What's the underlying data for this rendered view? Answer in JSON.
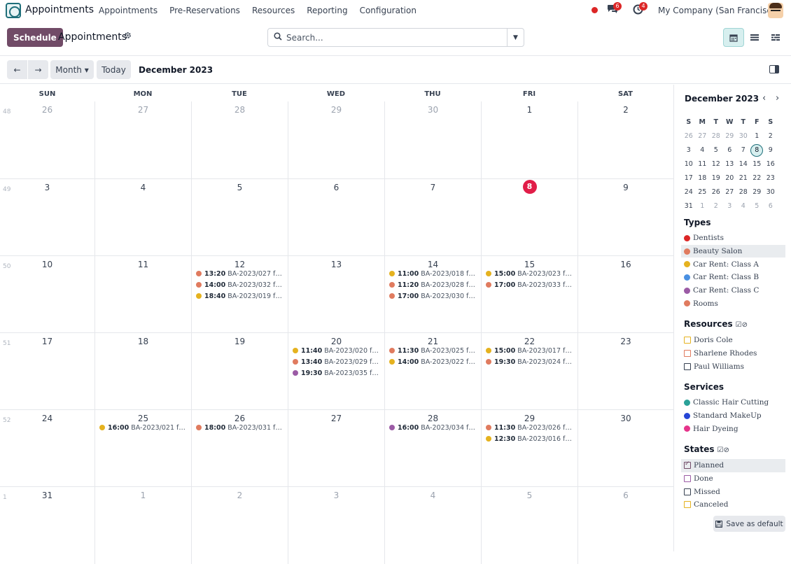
{
  "app": {
    "name": "Appointments"
  },
  "menu": [
    {
      "label": "Appointments"
    },
    {
      "label": "Pre-Reservations"
    },
    {
      "label": "Resources"
    },
    {
      "label": "Reporting"
    },
    {
      "label": "Configuration"
    }
  ],
  "systray": {
    "messages_count": "6",
    "activities_count": "4",
    "company": "My Company (San Francisco)",
    "status_color": "#dc2626"
  },
  "control_panel": {
    "schedule_label": "Schedule",
    "title": "Appointments",
    "search_placeholder": "Search..."
  },
  "toolbar": {
    "prev": "←",
    "next": "→",
    "scale_label": "Month ▾",
    "today_label": "Today",
    "range_title": "December 2023"
  },
  "weekdays": [
    "SUN",
    "MON",
    "TUE",
    "WED",
    "THU",
    "FRI",
    "SAT"
  ],
  "weeks": [
    {
      "num": "48",
      "days": [
        {
          "n": "26",
          "muted": true
        },
        {
          "n": "27",
          "muted": true
        },
        {
          "n": "28",
          "muted": true
        },
        {
          "n": "29",
          "muted": true
        },
        {
          "n": "30",
          "muted": true
        },
        {
          "n": "1"
        },
        {
          "n": "2"
        }
      ]
    },
    {
      "num": "49",
      "days": [
        {
          "n": "3"
        },
        {
          "n": "4"
        },
        {
          "n": "5"
        },
        {
          "n": "6"
        },
        {
          "n": "7"
        },
        {
          "n": "8",
          "today": true
        },
        {
          "n": "9"
        }
      ]
    },
    {
      "num": "50",
      "days": [
        {
          "n": "10"
        },
        {
          "n": "11"
        },
        {
          "n": "12",
          "events": [
            {
              "time": "13:20",
              "title": "BA-2023/027 for ...",
              "color": "#e07b5f"
            },
            {
              "time": "14:00",
              "title": "BA-2023/032 for ...",
              "color": "#e07b5f"
            },
            {
              "time": "18:40",
              "title": "BA-2023/019 for ...",
              "color": "#e5b21f"
            }
          ]
        },
        {
          "n": "13"
        },
        {
          "n": "14",
          "events": [
            {
              "time": "11:00",
              "title": "BA-2023/018 for ...",
              "color": "#e5b21f"
            },
            {
              "time": "11:20",
              "title": "BA-2023/028 for ...",
              "color": "#e07b5f"
            },
            {
              "time": "17:00",
              "title": "BA-2023/030 for ...",
              "color": "#e07b5f"
            }
          ]
        },
        {
          "n": "15",
          "events": [
            {
              "time": "15:00",
              "title": "BA-2023/023 for ...",
              "color": "#e5b21f"
            },
            {
              "time": "17:00",
              "title": "BA-2023/033 for ...",
              "color": "#e07b5f"
            }
          ]
        },
        {
          "n": "16"
        }
      ]
    },
    {
      "num": "51",
      "days": [
        {
          "n": "17"
        },
        {
          "n": "18"
        },
        {
          "n": "19"
        },
        {
          "n": "20",
          "events": [
            {
              "time": "11:40",
              "title": "BA-2023/020 for ...",
              "color": "#e5b21f"
            },
            {
              "time": "13:40",
              "title": "BA-2023/029 for ...",
              "color": "#e07b5f"
            },
            {
              "time": "19:30",
              "title": "BA-2023/035 for ...",
              "color": "#9b5ba5"
            }
          ]
        },
        {
          "n": "21",
          "events": [
            {
              "time": "11:30",
              "title": "BA-2023/025 for ...",
              "color": "#e07b5f"
            },
            {
              "time": "14:00",
              "title": "BA-2023/022 for ...",
              "color": "#e5b21f"
            }
          ]
        },
        {
          "n": "22",
          "events": [
            {
              "time": "15:00",
              "title": "BA-2023/017 for ...",
              "color": "#e5b21f"
            },
            {
              "time": "19:30",
              "title": "BA-2023/024 for ...",
              "color": "#e07b5f"
            }
          ]
        },
        {
          "n": "23"
        }
      ]
    },
    {
      "num": "52",
      "days": [
        {
          "n": "24"
        },
        {
          "n": "25",
          "events": [
            {
              "time": "16:00",
              "title": "BA-2023/021 for ...",
              "color": "#e5b21f"
            }
          ]
        },
        {
          "n": "26",
          "events": [
            {
              "time": "18:00",
              "title": "BA-2023/031 for ...",
              "color": "#e07b5f"
            }
          ]
        },
        {
          "n": "27"
        },
        {
          "n": "28",
          "events": [
            {
              "time": "16:00",
              "title": "BA-2023/034 for ...",
              "color": "#9b5ba5"
            }
          ]
        },
        {
          "n": "29",
          "events": [
            {
              "time": "11:30",
              "title": "BA-2023/026 for ...",
              "color": "#e07b5f"
            },
            {
              "time": "12:30",
              "title": "BA-2023/016 for ...",
              "color": "#e5b21f"
            }
          ]
        },
        {
          "n": "30"
        }
      ]
    },
    {
      "num": "1",
      "days": [
        {
          "n": "31"
        },
        {
          "n": "1",
          "muted": true
        },
        {
          "n": "2",
          "muted": true
        },
        {
          "n": "3",
          "muted": true
        },
        {
          "n": "4",
          "muted": true
        },
        {
          "n": "5",
          "muted": true
        },
        {
          "n": "6",
          "muted": true
        }
      ]
    }
  ],
  "mini_calendar": {
    "title": "December 2023",
    "prev": "‹",
    "next": "›",
    "weekdays": [
      "S",
      "M",
      "T",
      "W",
      "T",
      "F",
      "S"
    ],
    "rows": [
      [
        "26",
        "27",
        "28",
        "29",
        "30",
        "1",
        "2"
      ],
      [
        "3",
        "4",
        "5",
        "6",
        "7",
        "8",
        "9"
      ],
      [
        "10",
        "11",
        "12",
        "13",
        "14",
        "15",
        "16"
      ],
      [
        "17",
        "18",
        "19",
        "20",
        "21",
        "22",
        "23"
      ],
      [
        "24",
        "25",
        "26",
        "27",
        "28",
        "29",
        "30"
      ],
      [
        "31",
        "1",
        "2",
        "3",
        "4",
        "5",
        "6"
      ]
    ],
    "selected": "8"
  },
  "filters": {
    "types": {
      "title": "Types",
      "items": [
        {
          "label": "Dentists",
          "color": "#dc2626"
        },
        {
          "label": "Beauty Salon",
          "color": "#e07b5f",
          "highlighted": true
        },
        {
          "label": "Car Rent: Class A",
          "color": "#e5b21f"
        },
        {
          "label": "Car Rent: Class B",
          "color": "#4a90e2"
        },
        {
          "label": "Car Rent: Class C",
          "color": "#9b5ba5"
        },
        {
          "label": "Rooms",
          "color": "#e07b5f"
        }
      ]
    },
    "resources": {
      "title": "Resources",
      "items": [
        {
          "label": "Doris Cole",
          "color": "#e5b21f"
        },
        {
          "label": "Sharlene Rhodes",
          "color": "#e07b5f"
        },
        {
          "label": "Paul Williams",
          "color": "#374151"
        }
      ]
    },
    "services": {
      "title": "Services",
      "items": [
        {
          "label": "Classic Hair Cutting",
          "color": "#2aa198"
        },
        {
          "label": "Standard MakeUp",
          "color": "#2545d6"
        },
        {
          "label": "Hair Dyeing",
          "color": "#e6348b"
        }
      ]
    },
    "states": {
      "title": "States",
      "items": [
        {
          "label": "Planned",
          "color": "#714b67",
          "checked": true,
          "highlighted": true
        },
        {
          "label": "Done",
          "color": "#9b5ba5"
        },
        {
          "label": "Missed",
          "color": "#374151"
        },
        {
          "label": "Canceled",
          "color": "#e5b21f"
        }
      ]
    }
  },
  "save_default_label": "Save as default"
}
